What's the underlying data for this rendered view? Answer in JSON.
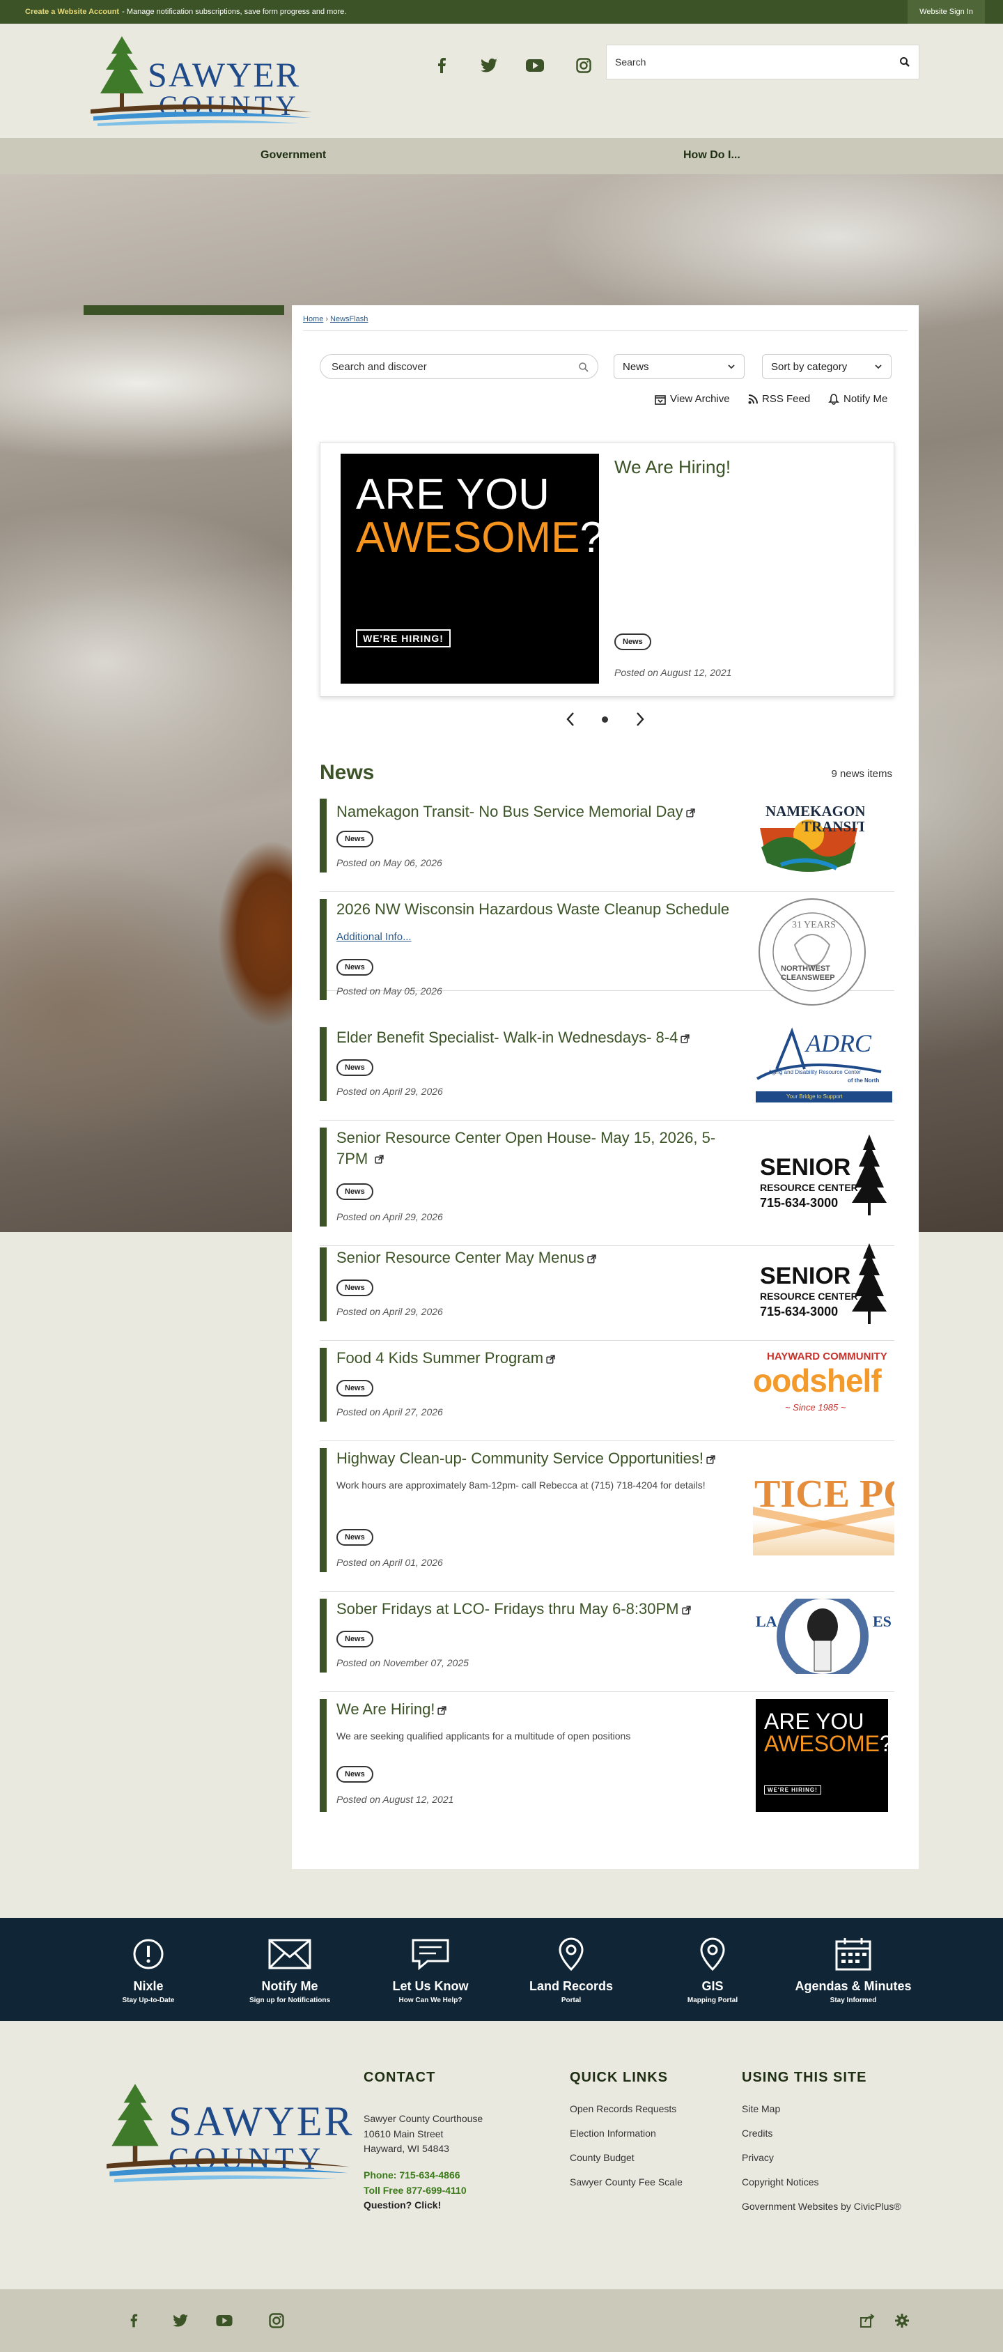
{
  "topbar": {
    "create_account": "Create a Website Account",
    "create_desc": "- Manage notification subscriptions, save form progress and more.",
    "sign_in": "Website Sign In"
  },
  "logo": {
    "line1": "SAWYER",
    "line2": "COUNTY"
  },
  "social": [
    "facebook-icon",
    "twitter-icon",
    "youtube-icon",
    "instagram-icon"
  ],
  "search": {
    "placeholder": "Search"
  },
  "nav": {
    "government": "Government",
    "how_do_i": "How Do I..."
  },
  "breadcrumb": {
    "home": "Home",
    "current": "NewsFlash",
    "separator": "›"
  },
  "filters": {
    "search_placeholder": "Search and discover",
    "category": "News",
    "sort": "Sort by category"
  },
  "tools": {
    "archive": "View Archive",
    "rss": "RSS Feed",
    "notify": "Notify Me"
  },
  "featured": {
    "title": "We Are Hiring!",
    "tag": "News",
    "posted": "Posted on August 12, 2021",
    "image": {
      "line1": "ARE YOU",
      "line2": "AWESOME",
      "q": "?",
      "badge": "WE'RE HIRING!"
    }
  },
  "news": {
    "heading": "News",
    "count": "9 news items",
    "items": [
      {
        "title": "Namekagon Transit- No Bus Service Memorial Day",
        "tag": "News",
        "posted": "Posted on May 06, 2026"
      },
      {
        "title": "2026 NW Wisconsin Hazardous Waste Cleanup Schedule",
        "link": "Additional Info...",
        "tag": "News",
        "posted": "Posted on May 05, 2026"
      },
      {
        "title": "Elder Benefit Specialist- Walk-in Wednesdays- 8-4",
        "tag": "News",
        "posted": "Posted on April 29, 2026"
      },
      {
        "title": "Senior Resource Center Open House- May 15, 2026, 5-7PM",
        "tag": "News",
        "posted": "Posted on April 29, 2026"
      },
      {
        "title": "Senior Resource Center May Menus",
        "tag": "News",
        "posted": "Posted on April 29, 2026"
      },
      {
        "title": "Food 4 Kids Summer Program",
        "tag": "News",
        "posted": "Posted on April 27, 2026"
      },
      {
        "title": "Highway Clean-up- Community Service Opportunities!",
        "desc": "Work hours are approximately 8am-12pm- call Rebecca at (715) 718-4204 for details!",
        "tag": "News",
        "posted": "Posted on April 01, 2026"
      },
      {
        "title": "Sober Fridays at LCO- Fridays thru May 6-8:30PM",
        "tag": "News",
        "posted": "Posted on November 07, 2025"
      },
      {
        "title": "We Are Hiring!",
        "desc": "We are seeking qualified applicants for a multitude of open positions",
        "tag": "News",
        "posted": "Posted on August 12, 2021"
      }
    ],
    "thumbs": {
      "namekagon": {
        "line1": "NAMEKAGON",
        "line2": "TRANSIT"
      },
      "cleansweep": {
        "years": "31 YEARS",
        "name1": "NORTHWEST",
        "name2": "CLEANSWEEP"
      },
      "adrc": {
        "name": "ADRC",
        "sub1": "Aging and Disability Resource Center",
        "sub2": "of the North",
        "tag": "Your Bridge to Support"
      },
      "senior": {
        "line1": "SENIOR",
        "line2": "RESOURCE CENTER",
        "phone": "715-634-3000"
      },
      "foodshelf": {
        "top": "HAYWARD COMMUNITY",
        "name": "oodshelf",
        "since": "~ Since 1985 ~"
      },
      "highway": {
        "text": "TICE PO"
      },
      "lco": {
        "l": "LA",
        "r": "ES"
      }
    }
  },
  "quicklinks": [
    {
      "icon": "alert-icon",
      "title": "Nixle",
      "sub": "Stay Up-to-Date"
    },
    {
      "icon": "envelope-icon",
      "title": "Notify Me",
      "sub": "Sign up for Notifications"
    },
    {
      "icon": "chat-icon",
      "title": "Let Us Know",
      "sub": "How Can We Help?"
    },
    {
      "icon": "map-pin-icon",
      "title": "Land Records",
      "sub": "Portal"
    },
    {
      "icon": "map-pin-icon",
      "title": "GIS",
      "sub": "Mapping Portal"
    },
    {
      "icon": "calendar-icon",
      "title": "Agendas & Minutes",
      "sub": "Stay Informed"
    }
  ],
  "footer": {
    "contact": {
      "heading": "CONTACT",
      "line1": "Sawyer County Courthouse",
      "line2": "10610 Main Street",
      "line3": "Hayward, WI 54843",
      "phone": "Phone: 715-634-4866",
      "tollfree": "Toll Free 877-699-4110",
      "question": "Question? Click!"
    },
    "quick": {
      "heading": "QUICK LINKS",
      "links": [
        "Open Records Requests",
        "Election Information",
        "County Budget",
        "Sawyer County Fee Scale"
      ]
    },
    "site": {
      "heading": "USING THIS SITE",
      "links": [
        "Site Map",
        "Credits",
        "Privacy",
        "Copyright Notices",
        "Government Websites by CivicPlus®"
      ]
    }
  },
  "colors": {
    "brand_green": "#3b5326",
    "navy": "#102636",
    "logo_blue": "#1f4a8a"
  }
}
